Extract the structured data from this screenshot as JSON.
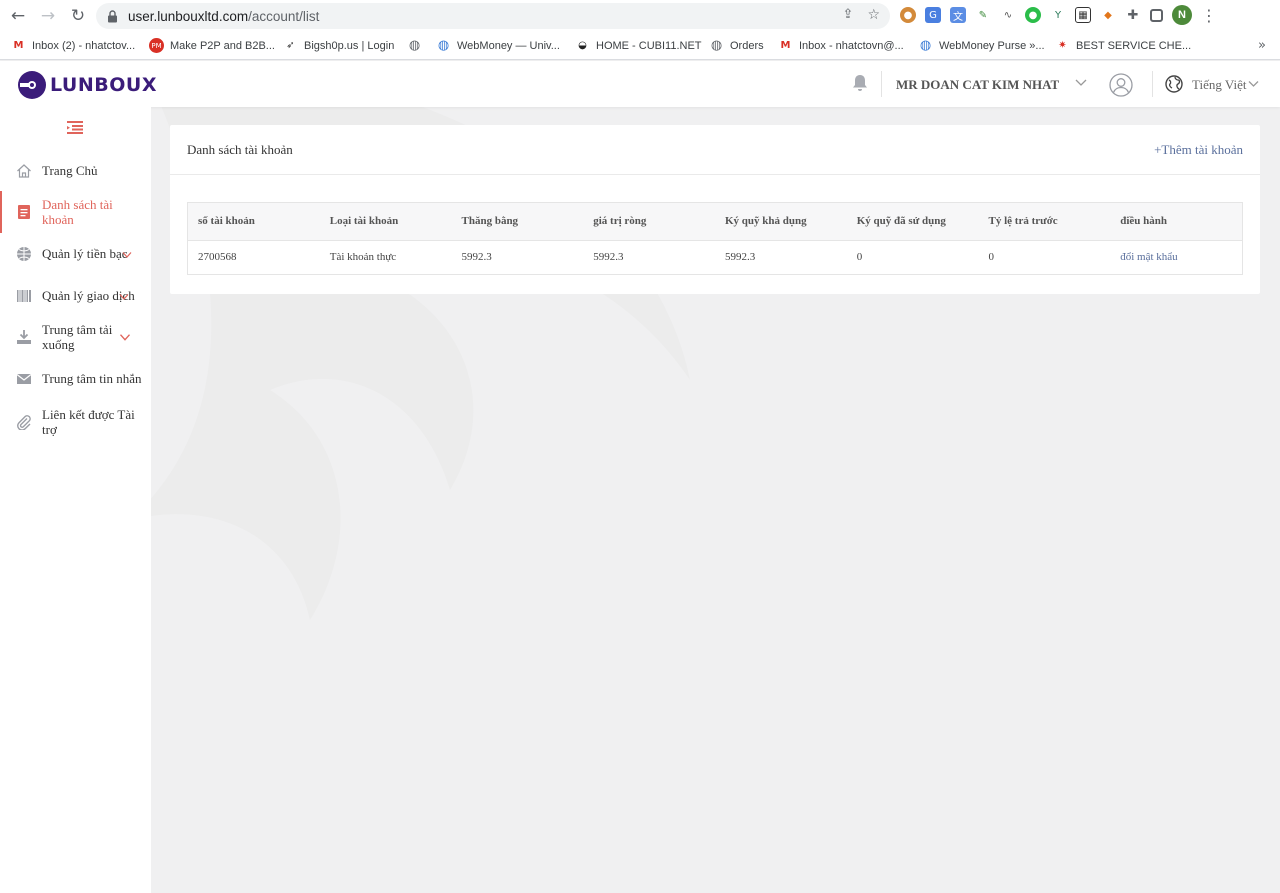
{
  "browser": {
    "url_host": "user.lunbouxltd.com",
    "url_path": "/account/list",
    "profile_initial": "N",
    "bookmarks": [
      {
        "label": "Inbox (2) - nhatctov...",
        "icon": "gmail-icon"
      },
      {
        "label": "Make P2P and B2B...",
        "icon": "pm-icon"
      },
      {
        "label": "Bigsh0p.us | Login",
        "icon": "rocket-icon"
      },
      {
        "label": "",
        "icon": "globe-icon"
      },
      {
        "label": "WebMoney — Univ...",
        "icon": "webmoney-icon"
      },
      {
        "label": "HOME - CUBI11.NET",
        "icon": "eye-icon"
      },
      {
        "label": "Orders",
        "icon": "globe-icon"
      },
      {
        "label": "Inbox - nhatctovn@...",
        "icon": "gmail-icon"
      },
      {
        "label": "WebMoney Purse »...",
        "icon": "webmoney-icon"
      },
      {
        "label": "BEST SERVICE CHE...",
        "icon": "star-icon"
      }
    ],
    "bookmarks_more": "»"
  },
  "header": {
    "logo_text": "LUNBOUX",
    "user_name": "MR DOAN CAT KIM NHAT",
    "language": "Tiếng Việt"
  },
  "sidebar": {
    "items": [
      {
        "label": "Trang Chủ"
      },
      {
        "label": "Danh sách tài khoản"
      },
      {
        "label": "Quản lý tiền bạc"
      },
      {
        "label": "Quản lý giao dịch"
      },
      {
        "label": "Trung tâm tải xuống"
      },
      {
        "label": "Trung tâm tin nhắn"
      },
      {
        "label": "Liên kết được Tài trợ"
      }
    ]
  },
  "main": {
    "title": "Danh sách tài khoản",
    "add_account": "+Thêm tài khoản",
    "table": {
      "headers": [
        "số tài khoản",
        "Loại tài khoản",
        "Thăng bằng",
        "giá trị ròng",
        "Ký quỹ khả dụng",
        "Ký quỹ đã sử dụng",
        "Tỷ lệ trả trước",
        "điều hành"
      ],
      "rows": [
        [
          "2700568",
          "Tài khoản thực",
          "5992.3",
          "5992.3",
          "5992.3",
          "0",
          "0",
          "đổi mật khẩu"
        ]
      ]
    }
  },
  "colors": {
    "accent": "#e0645b",
    "brand": "#3b1c7a",
    "link": "#5a6f9c"
  }
}
